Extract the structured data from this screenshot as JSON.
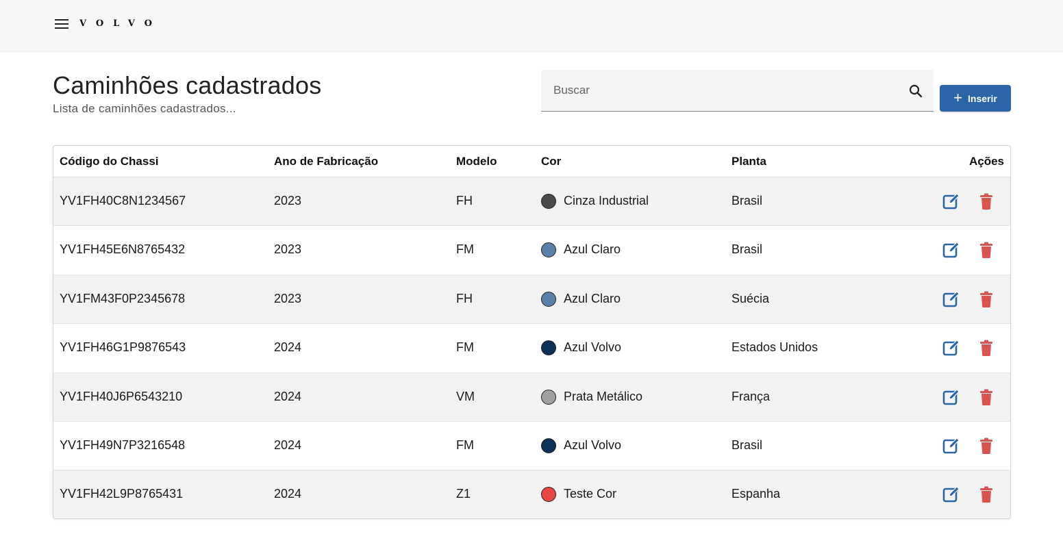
{
  "header": {
    "logo": "VOLVO",
    "menu_icon": "hamburger-menu-icon"
  },
  "page": {
    "title": "Caminhões cadastrados",
    "subtitle": "Lista de caminhões cadastrados..."
  },
  "search": {
    "placeholder": "Buscar",
    "value": "",
    "icon": "search-icon"
  },
  "insert_button": {
    "label": "Inserir",
    "icon": "plus-icon",
    "color": "#2c65a7"
  },
  "table": {
    "columns": {
      "chassi": "Código do Chassi",
      "ano": "Ano de Fabricação",
      "modelo": "Modelo",
      "cor": "Cor",
      "planta": "Planta",
      "acoes": "Ações"
    },
    "rows": [
      {
        "chassi": "YV1FH40C8N1234567",
        "ano": "2023",
        "modelo": "FH",
        "cor": "Cinza Industrial",
        "cor_hex": "#4a4a4a",
        "planta": "Brasil"
      },
      {
        "chassi": "YV1FH45E6N8765432",
        "ano": "2023",
        "modelo": "FM",
        "cor": "Azul Claro",
        "cor_hex": "#5b7fa6",
        "planta": "Brasil"
      },
      {
        "chassi": "YV1FM43F0P2345678",
        "ano": "2023",
        "modelo": "FH",
        "cor": "Azul Claro",
        "cor_hex": "#5b7fa6",
        "planta": "Suécia"
      },
      {
        "chassi": "YV1FH46G1P9876543",
        "ano": "2024",
        "modelo": "FM",
        "cor": "Azul Volvo",
        "cor_hex": "#0e2f56",
        "planta": "Estados Unidos"
      },
      {
        "chassi": "YV1FH40J6P6543210",
        "ano": "2024",
        "modelo": "VM",
        "cor": "Prata Metálico",
        "cor_hex": "#a0a0a0",
        "planta": "França"
      },
      {
        "chassi": "YV1FH49N7P3216548",
        "ano": "2024",
        "modelo": "FM",
        "cor": "Azul Volvo",
        "cor_hex": "#0e2f56",
        "planta": "Brasil"
      },
      {
        "chassi": "YV1FH42L9P8765431",
        "ano": "2024",
        "modelo": "Z1",
        "cor": "Teste Cor",
        "cor_hex": "#e84545",
        "planta": "Espanha"
      }
    ],
    "actions": {
      "edit_icon": "edit-icon",
      "edit_color": "#2c65a7",
      "delete_icon": "trash-icon",
      "delete_color": "#d9534f"
    }
  }
}
